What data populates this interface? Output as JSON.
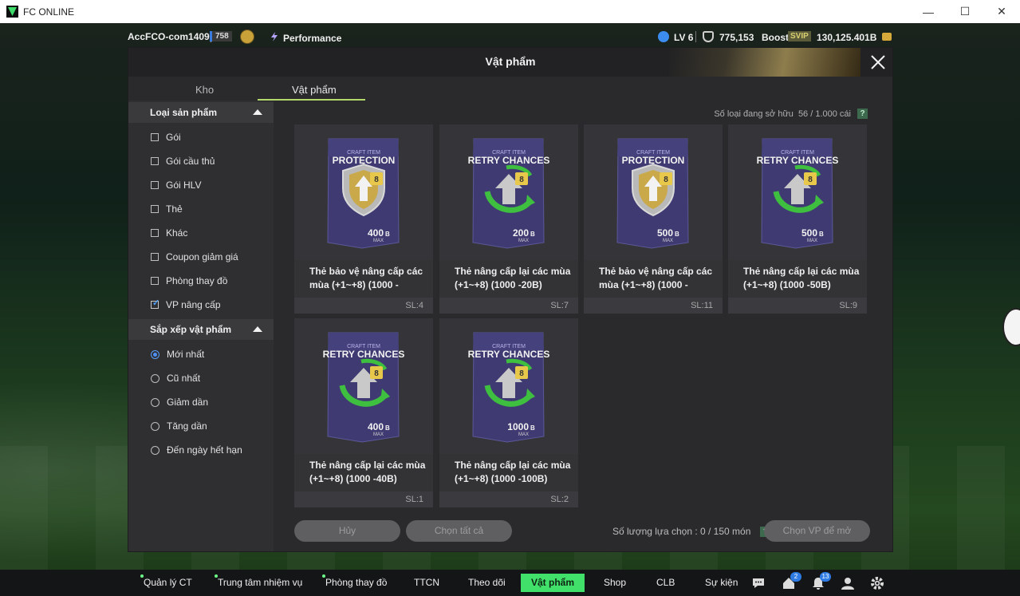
{
  "window": {
    "title": "FC ONLINE",
    "minimize": "—",
    "maximize": "☐",
    "close": "✕"
  },
  "topbar": {
    "account": "AccFCO-com1409p",
    "account_level": "758",
    "performance": "Performance",
    "lv": "LV 6",
    "points": "775,153",
    "boost": "Boost",
    "svip": "SVIP",
    "bp": "130,125.401B"
  },
  "modal": {
    "title": "Vật phẩm",
    "tabs": [
      "Kho",
      "Vật phẩm"
    ],
    "active_tab": "Vật phẩm",
    "owned_label": "Số loại đang sở hữu",
    "owned_value": "56 / 1.000 cái",
    "help": "?"
  },
  "sidebar": {
    "product_type": {
      "title": "Loại sản phẩm",
      "options": [
        {
          "label": "Gói",
          "checked": false
        },
        {
          "label": "Gói cầu thủ",
          "checked": false
        },
        {
          "label": "Gói HLV",
          "checked": false
        },
        {
          "label": "Thẻ",
          "checked": false
        },
        {
          "label": "Khác",
          "checked": false
        },
        {
          "label": "Coupon giảm giá",
          "checked": false
        },
        {
          "label": "Phòng thay đồ",
          "checked": false
        },
        {
          "label": "VP nâng cấp",
          "checked": true
        }
      ]
    },
    "sort": {
      "title": "Sắp xếp vật phẩm",
      "options": [
        {
          "label": "Mới nhất",
          "selected": true
        },
        {
          "label": "Cũ nhất",
          "selected": false
        },
        {
          "label": "Giảm dần",
          "selected": false
        },
        {
          "label": "Tăng dần",
          "selected": false
        },
        {
          "label": "Đến ngày hết hạn",
          "selected": false
        }
      ]
    }
  },
  "items": [
    {
      "card_type": "PROTECTION",
      "craft_label": "CRAFT ITEM",
      "level": "8",
      "value": "400",
      "unit": "B",
      "max": "MAX",
      "name": "Thẻ bảo vệ nâng cấp các mùa (+1~+8) (1000 -",
      "qty": "SL:4"
    },
    {
      "card_type": "RETRY CHANCES",
      "craft_label": "CRAFT ITEM",
      "level": "8",
      "value": "200",
      "unit": "B",
      "max": "MAX",
      "name": "Thẻ nâng cấp lại các mùa (+1~+8) (1000 -20B)",
      "qty": "SL:7"
    },
    {
      "card_type": "PROTECTION",
      "craft_label": "CRAFT ITEM",
      "level": "8",
      "value": "500",
      "unit": "B",
      "max": "MAX",
      "name": "Thẻ bảo vệ nâng cấp các mùa (+1~+8) (1000 -",
      "qty": "SL:11"
    },
    {
      "card_type": "RETRY CHANCES",
      "craft_label": "CRAFT ITEM",
      "level": "8",
      "value": "500",
      "unit": "B",
      "max": "MAX",
      "name": "Thẻ nâng cấp lại các mùa (+1~+8) (1000 -50B)",
      "qty": "SL:9"
    },
    {
      "card_type": "RETRY CHANCES",
      "craft_label": "CRAFT ITEM",
      "level": "8",
      "value": "400",
      "unit": "B",
      "max": "MAX",
      "name": "Thẻ nâng cấp lại các mùa (+1~+8) (1000 -40B)",
      "qty": "SL:1"
    },
    {
      "card_type": "RETRY CHANCES",
      "craft_label": "CRAFT ITEM",
      "level": "8",
      "value": "1000",
      "unit": "B",
      "max": "MAX",
      "name": "Thẻ nâng cấp lại các mùa (+1~+8) (1000 -100B)",
      "qty": "SL:2"
    }
  ],
  "footer": {
    "cancel": "Hủy",
    "select_all": "Chọn tất cả",
    "selection_label": "Số lượng lựa chọn : 0 / 150 món",
    "confirm": "Chọn VP để mở"
  },
  "bottomnav": {
    "items": [
      "Quản lý CT",
      "Trung tâm nhiệm vụ",
      "Phòng thay đồ",
      "TTCN",
      "Theo dõi",
      "Vật phẩm",
      "Shop",
      "CLB",
      "Sự kiện"
    ],
    "badges": {
      "home": "2",
      "notifications": "13"
    }
  },
  "colors": {
    "accent_green": "#40e06a",
    "tab_underline": "#b3d96d",
    "checkbox_tick": "#4ea1ff"
  }
}
